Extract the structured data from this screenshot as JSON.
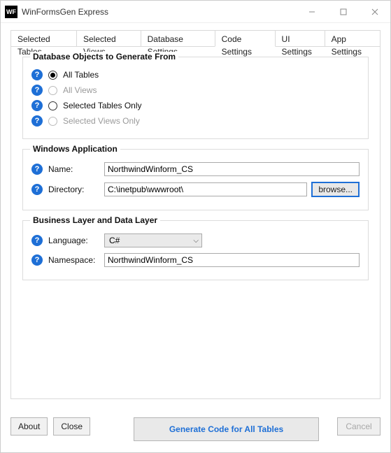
{
  "window": {
    "title": "WinFormsGen Express",
    "icon_text": "WF"
  },
  "tabs": [
    {
      "label": "Selected Tables",
      "active": false
    },
    {
      "label": "Selected Views",
      "active": false
    },
    {
      "label": "Database Settings",
      "active": false
    },
    {
      "label": "Code Settings",
      "active": true
    },
    {
      "label": "UI Settings",
      "active": false
    },
    {
      "label": "App Settings",
      "active": false
    }
  ],
  "group_db_objects": {
    "legend": "Database Objects to Generate From",
    "options": [
      {
        "label": "All Tables",
        "checked": true,
        "enabled": true
      },
      {
        "label": "All Views",
        "checked": false,
        "enabled": false
      },
      {
        "label": "Selected Tables Only",
        "checked": false,
        "enabled": true
      },
      {
        "label": "Selected Views Only",
        "checked": false,
        "enabled": false
      }
    ]
  },
  "group_winapp": {
    "legend": "Windows Application",
    "name_label": "Name:",
    "name_value": "NorthwindWinform_CS",
    "dir_label": "Directory:",
    "dir_value": "C:\\inetpub\\wwwroot\\",
    "browse_label": "browse..."
  },
  "group_biz": {
    "legend": "Business Layer and Data Layer",
    "lang_label": "Language:",
    "lang_value": "C#",
    "ns_label": "Namespace:",
    "ns_value": "NorthwindWinform_CS"
  },
  "footer": {
    "about": "About",
    "close": "Close",
    "generate": "Generate Code for All Tables",
    "cancel": "Cancel"
  }
}
